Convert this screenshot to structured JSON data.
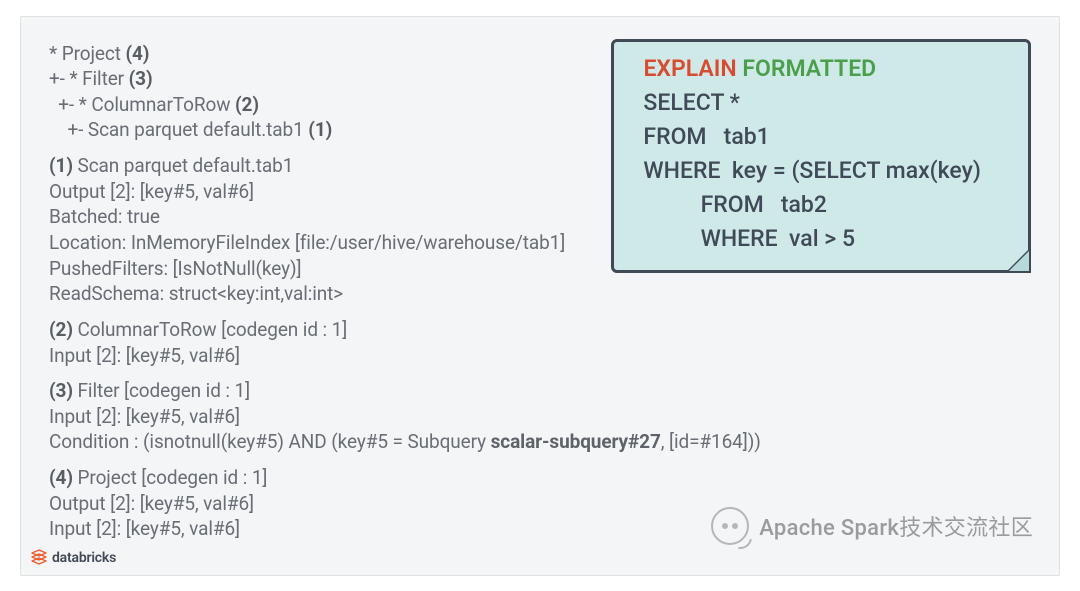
{
  "plan": {
    "tree": {
      "l1": {
        "prefix": "* Project ",
        "id": "(4)"
      },
      "l2": {
        "prefix": "+- * Filter ",
        "id": "(3)"
      },
      "l3": {
        "prefix": "  +- * ColumnarToRow ",
        "id": "(2)"
      },
      "l4": {
        "prefix": "    +- Scan parquet default.tab1 ",
        "id": "(1)"
      }
    },
    "n1": {
      "id": "(1)",
      "title": " Scan parquet default.tab1",
      "out": "Output [2]: [key#5, val#6]",
      "batched": "Batched: true",
      "loc": "Location: InMemoryFileIndex [file:/user/hive/warehouse/tab1]",
      "pf": "PushedFilters: [IsNotNull(key)]",
      "rs": "ReadSchema: struct<key:int,val:int>"
    },
    "n2": {
      "id": "(2)",
      "title": " ColumnarToRow [codegen id : 1]",
      "in": "Input [2]: [key#5, val#6]"
    },
    "n3": {
      "id": "(3)",
      "title": " Filter [codegen id : 1]",
      "in": "Input [2]: [key#5, val#6]",
      "cond_pre": "Condition : (isnotnull(key#5) AND (key#5 = Subquery ",
      "cond_sub": "scalar-subquery#27",
      "cond_post": ", [id=#164]))"
    },
    "n4": {
      "id": "(4)",
      "title": " Project [codegen id : 1]",
      "out": "Output [2]: [key#5, val#6]",
      "in": "Input [2]: [key#5, val#6]"
    }
  },
  "sql": {
    "explain": "EXPLAIN",
    "formatted": "FORMATTED",
    "l1": "  SELECT *",
    "l2": "  FROM   tab1",
    "l3": "  WHERE  key = (SELECT max(key)",
    "l4": "            FROM   tab2",
    "l5": "            WHERE  val > 5"
  },
  "brand": {
    "name": "databricks"
  },
  "watermark": {
    "text": "Apache Spark技术交流社区"
  }
}
